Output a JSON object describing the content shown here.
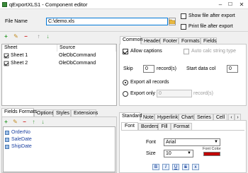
{
  "window": {
    "title": "qExportXLS1 - Component editor",
    "minimize": "–",
    "maximize": "☐",
    "close": "✕"
  },
  "file": {
    "label": "File Name",
    "value": "C:\\demo.xls",
    "browse_icon": "folder-icon"
  },
  "options": {
    "show_after_export": "Show file after export",
    "print_after_export": "Print file after export"
  },
  "toolbar_sheets": {
    "add": "+",
    "edit": "✎",
    "remove": "−",
    "up": "↑",
    "down": "↓"
  },
  "sheets": {
    "col_sheet": "Sheet",
    "col_source": "Source",
    "rows": [
      {
        "name": "Sheet 1",
        "source": "OleDbCommand",
        "checked": true
      },
      {
        "name": "Sheet 2",
        "source": "OleDbCommand",
        "checked": true
      }
    ]
  },
  "top_tabs": [
    "Common",
    "Header",
    "Footer",
    "Formats",
    "Fields"
  ],
  "common": {
    "allow_captions": "Allow captions",
    "auto_calc": "Auto calc string type",
    "skip_label": "Skip",
    "skip_value": "0",
    "records_label": "record(s)",
    "start_col_label": "Start data col",
    "start_col_value": "0",
    "export_all": "Export all records",
    "export_only": "Export only",
    "export_only_value": "0",
    "export_only_unit": "record(s)"
  },
  "left_tabs": [
    "Fields Formats",
    "Options",
    "Styles",
    "Extensions"
  ],
  "fields": {
    "items": [
      "OrderNo",
      "SaleDate",
      "ShipDate"
    ]
  },
  "format_tabs": [
    "Standard",
    "Note",
    "Hyperlink",
    "Chart",
    "Series",
    "Cell"
  ],
  "format_subtabs": [
    "Font",
    "Borders",
    "Fill",
    "Format"
  ],
  "font": {
    "font_label": "Font",
    "font_value": "Arial",
    "size_label": "Size",
    "size_value": "10",
    "color_label": "Font Color",
    "color": "#c00000",
    "style_buttons": [
      "B",
      "I",
      "U",
      "S",
      "x"
    ]
  }
}
